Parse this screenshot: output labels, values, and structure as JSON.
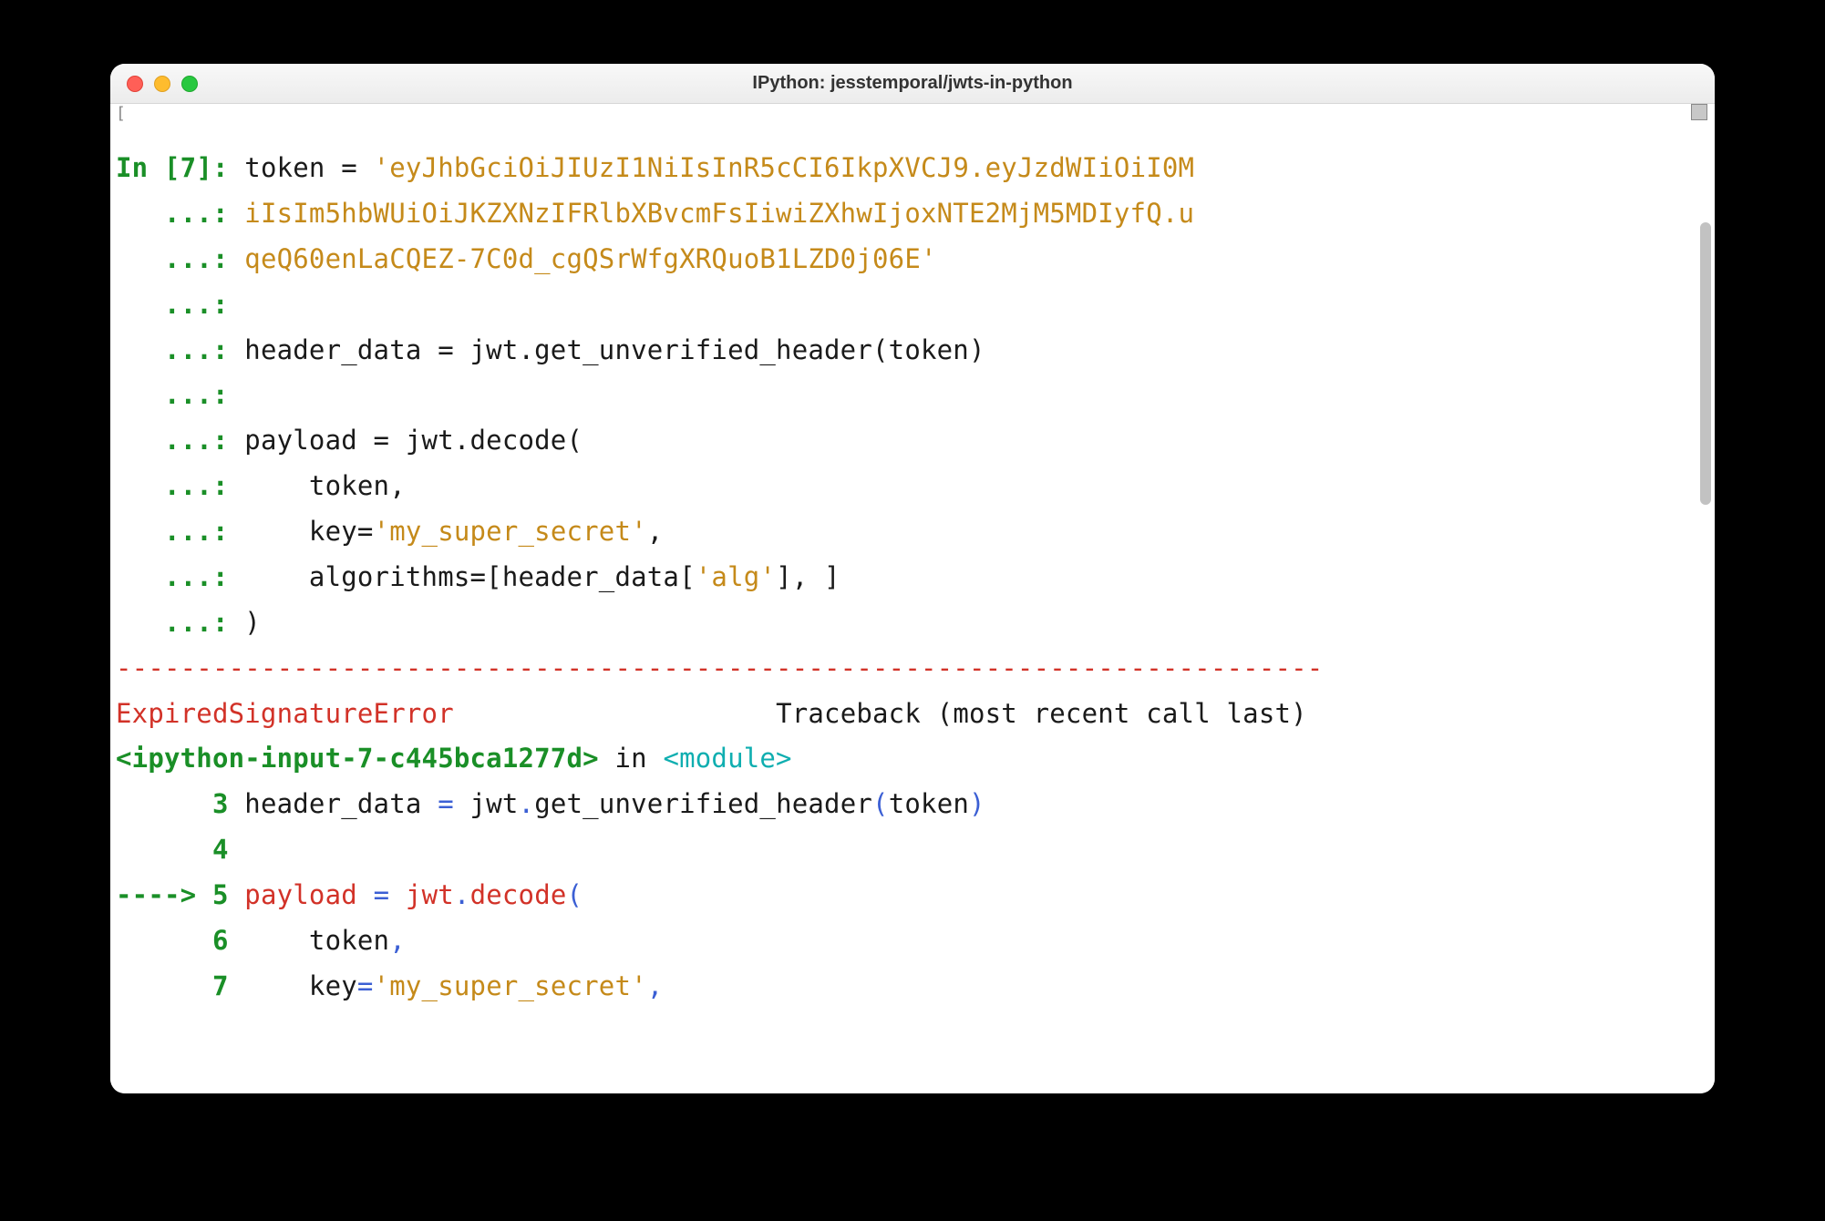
{
  "window": {
    "title": "IPython: jesstemporal/jwts-in-python"
  },
  "terminal": {
    "prompt_in": "In [",
    "prompt_num": "7",
    "prompt_close": "]: ",
    "continuation": "   ...: ",
    "code": {
      "line1_pre": "token = ",
      "line1_str": "'eyJhbGciOiJIUzI1NiIsInR5cCI6IkpXVCJ9.eyJzdWIiOiI0M",
      "line2_str": "iIsIm5hbWUiOiJKZXNzIFRlbXBvcmFsIiwiZXhwIjoxNTE2MjM5MDIyfQ.u",
      "line3_str": "qeQ60enLaCQEZ-7C0d_cgQSrWfgXRQuoB1LZD0j06E'",
      "line5": "header_data = jwt.get_unverified_header(token)",
      "line7": "payload = jwt.decode(",
      "line8": "    token,",
      "line9_pre": "    key=",
      "line9_str": "'my_super_secret'",
      "line9_post": ",",
      "line10_pre": "    algorithms=[header_data[",
      "line10_str": "'alg'",
      "line10_post": "], ]",
      "line11": ")"
    },
    "separator": "---------------------------------------------------------------------------",
    "error": {
      "name": "ExpiredSignatureError",
      "name_spaces": "                    ",
      "traceback_label": "Traceback (most recent call last)",
      "ipython_input": "<ipython-input-7-c445bca1277d>",
      "in_word": " in ",
      "module": "<module>",
      "tb_line3_num": "      3 ",
      "tb_line3_code": "header_data ",
      "tb_line3_eq": "=",
      "tb_line3_rest1": " jwt",
      "tb_line3_dot": ".",
      "tb_line3_rest2": "get_unverified_header",
      "tb_line3_paren": "(",
      "tb_line3_arg": "token",
      "tb_line3_close": ")",
      "tb_line4_num": "      4 ",
      "tb_arrow": "----> ",
      "tb_line5_num": "5 ",
      "tb_line5_code": "payload ",
      "tb_line5_eq": "=",
      "tb_line5_rest1": " jwt",
      "tb_line5_dot": ".",
      "tb_line5_rest2": "decode",
      "tb_line5_paren": "(",
      "tb_line6_num": "      6 ",
      "tb_line6_code": "    token",
      "tb_line6_comma": ",",
      "tb_line7_num": "      7 ",
      "tb_line7_pre": "    key",
      "tb_line7_eq": "=",
      "tb_line7_str": "'my_super_secret'",
      "tb_line7_comma": ","
    }
  }
}
